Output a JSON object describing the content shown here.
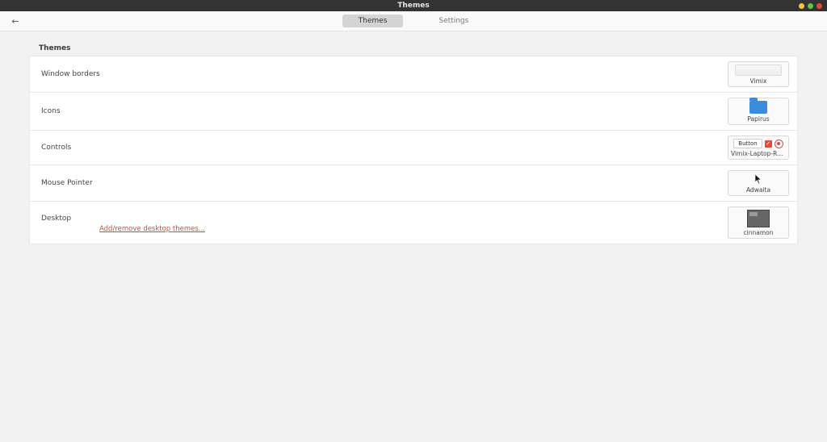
{
  "window": {
    "title": "Themes"
  },
  "toolbar": {
    "tabs": {
      "themes": "Themes",
      "settings": "Settings"
    }
  },
  "section_heading": "Themes",
  "rows": {
    "window_borders": {
      "label": "Window borders",
      "value": "Vimix"
    },
    "icons": {
      "label": "Icons",
      "value": "Papirus"
    },
    "controls": {
      "label": "Controls",
      "value": "Vimix-Laptop-Ruby",
      "button_text": "Button"
    },
    "mouse_pointer": {
      "label": "Mouse Pointer",
      "value": "Adwaita"
    },
    "desktop": {
      "label": "Desktop",
      "value": "cinnamon",
      "link": "Add/remove desktop themes..."
    }
  }
}
